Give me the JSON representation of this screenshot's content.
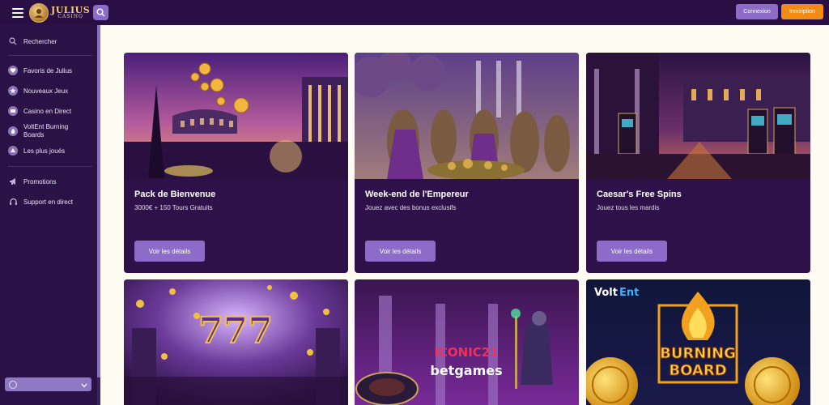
{
  "header": {
    "logo_line1": "JULIUS",
    "logo_line2": "CASINO",
    "login_label": "Connexion",
    "register_label": "Inscription"
  },
  "sidebar": {
    "search_label": "Rechercher",
    "items": [
      {
        "label": "Favoris de Julius",
        "icon": "heart-icon"
      },
      {
        "label": "Nouveaux Jeux",
        "icon": "star-icon"
      },
      {
        "label": "Casino en Direct",
        "icon": "live-casino-icon"
      },
      {
        "label": "VoltEnt Burning Boards",
        "icon": "fire-icon"
      },
      {
        "label": "Les plus joués",
        "icon": "trending-icon"
      }
    ],
    "promotions_label": "Promotions",
    "support_label": "Support en direct"
  },
  "promos": [
    {
      "title": "Pack de Bienvenue",
      "subtitle": "3000€ + 150 Tours Gratuits",
      "button": "Voir les détails"
    },
    {
      "title": "Week-end de l'Empereur",
      "subtitle": "Jouez avec des bonus exclusifs",
      "button": "Voir les détails"
    },
    {
      "title": "Caesar's Free Spins",
      "subtitle": "Jouez tous les mardis",
      "button": "Voir les détails"
    }
  ],
  "tiles": {
    "slots_symbols": "777",
    "iconic_brand": "ICONIC21",
    "betgames_brand": "betgames",
    "voltent_part1": "Volt",
    "voltent_part2": "Ent",
    "burning_line1": "BURNING",
    "burning_line2": "BOARD"
  },
  "colors": {
    "header_bg": "#2a0f45",
    "sidebar_bg": "#2b1246",
    "card_bg": "#2e1148",
    "accent_purple": "#8d6bc9",
    "accent_orange": "#f28a13",
    "page_bg": "#fdfbf2"
  }
}
